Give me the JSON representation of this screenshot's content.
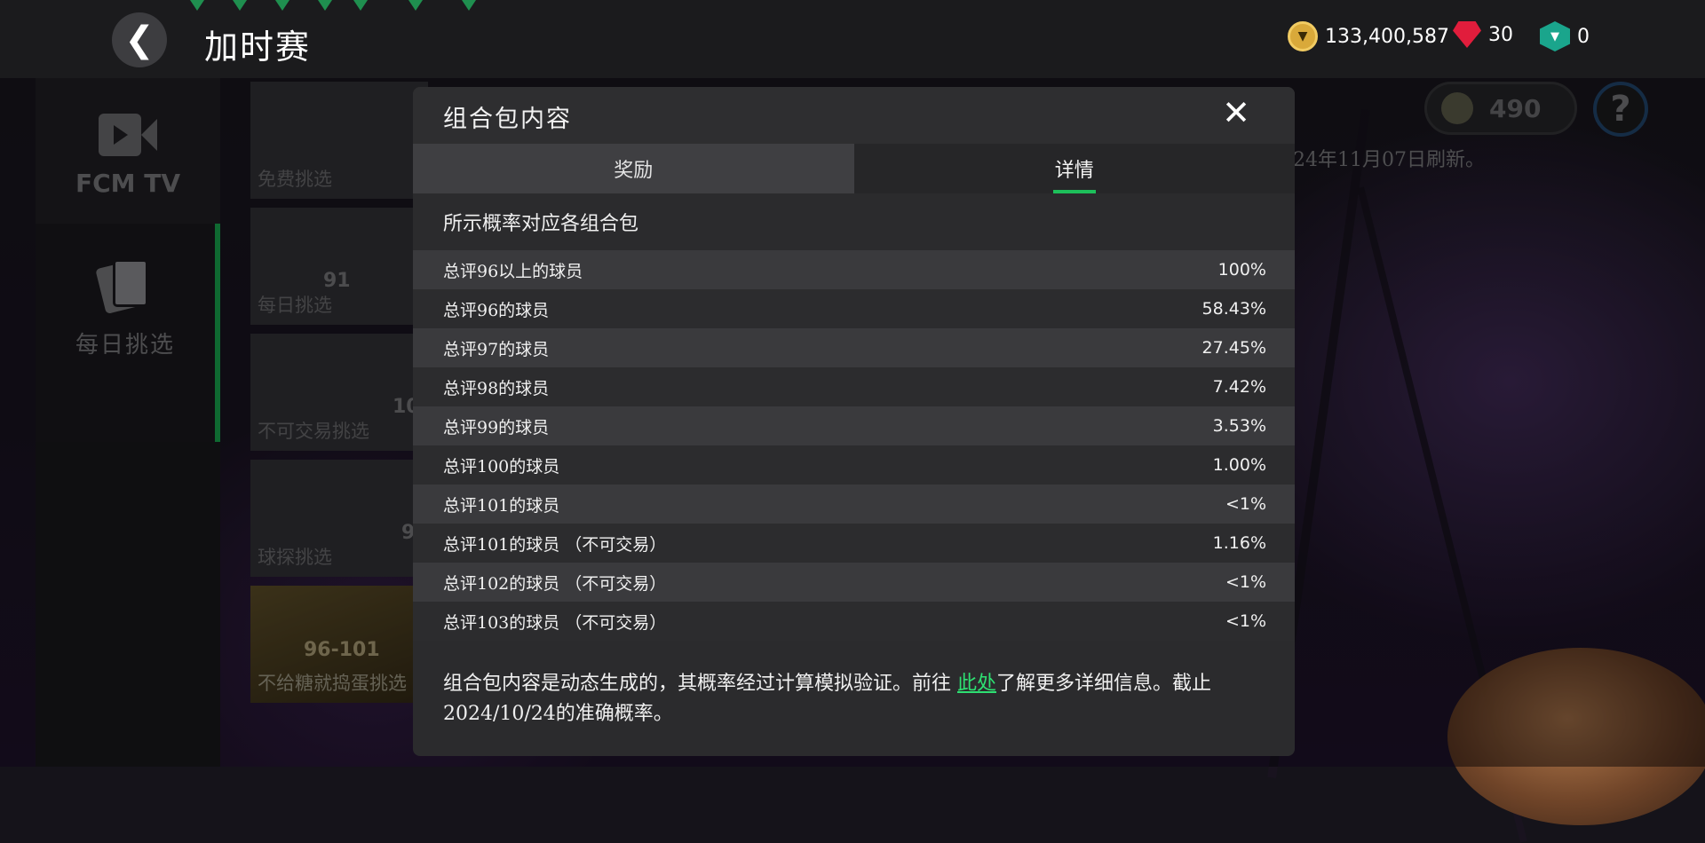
{
  "header": {
    "title": "加时赛",
    "back_label": "❮",
    "currencies": [
      {
        "icon": "fc-coin-icon",
        "value": "133,400,587"
      },
      {
        "icon": "red-gem-icon",
        "value": "30"
      },
      {
        "icon": "green-token-icon",
        "value": "0"
      }
    ]
  },
  "sidebar": {
    "items": [
      {
        "label": "FCM TV",
        "icon": "video-camera-icon"
      },
      {
        "label": "每日挑选",
        "icon": "cards-icon"
      }
    ]
  },
  "background_list": {
    "tiles": [
      {
        "label": "免费挑选",
        "number": ""
      },
      {
        "label": "每日挑选",
        "number": "91"
      },
      {
        "label": "不可交易挑选",
        "number": "10"
      },
      {
        "label": "球探挑选",
        "number": "9"
      },
      {
        "label": "不给糖就捣蛋挑选",
        "number": "96-101"
      }
    ]
  },
  "right_widgets": {
    "token_count": "490",
    "help_label": "?",
    "refresh_note": "24年11月07日刷新。"
  },
  "modal": {
    "title": "组合包内容",
    "close_label": "✕",
    "tabs": [
      {
        "label": "奖励",
        "active": false
      },
      {
        "label": "详情",
        "active": true
      }
    ],
    "section_title": "所示概率对应各组合包",
    "rows": [
      {
        "label": "总评96以上的球员",
        "value": "100%"
      },
      {
        "label": "总评96的球员",
        "value": "58.43%"
      },
      {
        "label": "总评97的球员",
        "value": "27.45%"
      },
      {
        "label": "总评98的球员",
        "value": "7.42%"
      },
      {
        "label": "总评99的球员",
        "value": "3.53%"
      },
      {
        "label": "总评100的球员",
        "value": "1.00%"
      },
      {
        "label": "总评101的球员",
        "value": "<1%"
      },
      {
        "label": "总评101的球员 （不可交易）",
        "value": "1.16%"
      },
      {
        "label": "总评102的球员 （不可交易）",
        "value": "<1%"
      },
      {
        "label": "总评103的球员 （不可交易）",
        "value": "<1%"
      }
    ],
    "footnote_before": "组合包内容是动态生成的，其概率经过计算模拟验证。前往 ",
    "footnote_link": "此处",
    "footnote_after": "了解更多详细信息。截止2024/10/24的准确概率。"
  },
  "colors": {
    "accent_green": "#1dbf5a",
    "link_green": "#2ee072",
    "modal_bg": "#2b2b2d"
  }
}
